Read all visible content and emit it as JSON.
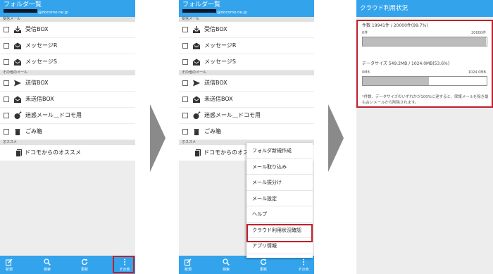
{
  "colors": {
    "accent": "#33a3ec",
    "highlight": "#c0202a",
    "arrow": "#8a8a8a"
  },
  "folder_screen": {
    "title": "フォルダ一覧",
    "account_suffix": "@docomo.ne.jp",
    "sections": {
      "inbox": "受信メール",
      "other": "その他のメール",
      "recommend": "オススメ"
    },
    "items": {
      "inbox_box": "受信BOX",
      "message_r": "メッセージR",
      "message_s": "メッセージS",
      "sent_box": "送信BOX",
      "unsent_box": "未送信BOX",
      "spam": "迷惑メール＿ドコモ用",
      "trash": "ごみ箱",
      "recommend": "ドコモからのオススメ",
      "recommend_truncated": "ドコモからのオス"
    },
    "icons": {
      "inbox_box": "inbox-tray-icon",
      "message": "envelope-open-icon",
      "sent_box": "send-arrow-icon",
      "unsent_box": "envelope-open-icon",
      "spam": "bomb-icon",
      "trash": "trash-can-icon",
      "recommend": "notebook-icon"
    },
    "bottom_tabs": [
      {
        "label": "新規",
        "icon": "compose-icon"
      },
      {
        "label": "検索",
        "icon": "search-icon"
      },
      {
        "label": "更新",
        "icon": "refresh-icon"
      },
      {
        "label": "その他",
        "icon": "more-vertical-icon"
      }
    ]
  },
  "overflow_menu": {
    "items": [
      "フォルダ新規作成",
      "メール取り込み",
      "メール振分け",
      "メール設定",
      "ヘルプ",
      "クラウド利用状況確認",
      "アプリ情報"
    ],
    "highlighted_index": 5
  },
  "cloud_screen": {
    "title": "クラウド利用状況",
    "count_text": "件数 19941件 / 20000件(99.7%)",
    "count_min": "0件",
    "count_max": "20000件",
    "count_fraction": 0.997,
    "size_text": "データサイズ 549.2MB / 1024.0MB(53.6%)",
    "size_min": "0MB",
    "size_max": "1024.0MB",
    "size_fraction": 0.536,
    "note": "*件数、データサイズのいずれかが100%に達すると、保護メールを除き最も古いメールから削除されます。"
  }
}
